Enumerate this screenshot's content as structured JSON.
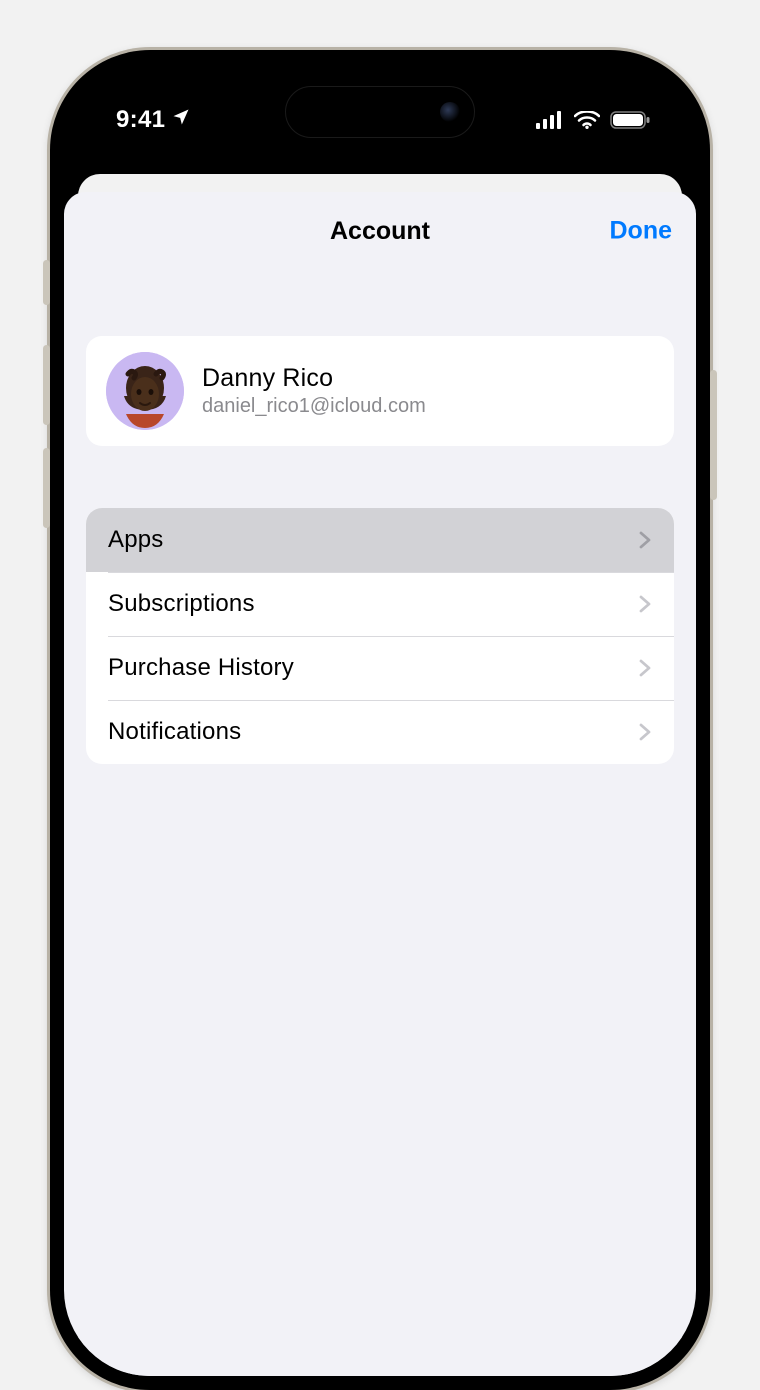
{
  "status": {
    "time": "9:41"
  },
  "sheet": {
    "title": "Account",
    "done": "Done"
  },
  "profile": {
    "name": "Danny Rico",
    "email": "daniel_rico1@icloud.com"
  },
  "menu": {
    "items": [
      {
        "label": "Apps",
        "highlighted": true
      },
      {
        "label": "Subscriptions",
        "highlighted": false
      },
      {
        "label": "Purchase History",
        "highlighted": false
      },
      {
        "label": "Notifications",
        "highlighted": false
      }
    ]
  },
  "colors": {
    "accent": "#007aff",
    "avatar_bg": "#c9b8f2"
  }
}
